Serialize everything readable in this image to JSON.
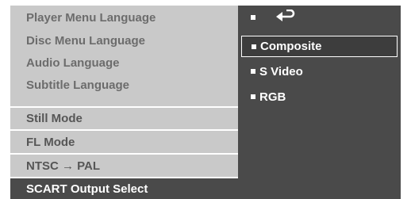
{
  "left_menu": {
    "items": [
      {
        "label": "Player Menu Language"
      },
      {
        "label": "Disc Menu Language"
      },
      {
        "label": "Audio Language"
      },
      {
        "label": "Subtitle Language"
      },
      {
        "label": "Still Mode"
      },
      {
        "label": "FL Mode"
      },
      {
        "label": "NTSC → PAL"
      },
      {
        "label": "SCART Output Select"
      }
    ],
    "selected_index": 7
  },
  "options": {
    "return_icon": "return-arrow-icon",
    "items": [
      {
        "label": "Composite"
      },
      {
        "label": "S Video"
      },
      {
        "label": "RGB"
      }
    ],
    "highlighted_index": 0
  },
  "colors": {
    "panel_light": "#c9c9c9",
    "panel_dark": "#4a4a4a",
    "text_light": "#ffffff",
    "text_grey": "#6c6c6c"
  }
}
